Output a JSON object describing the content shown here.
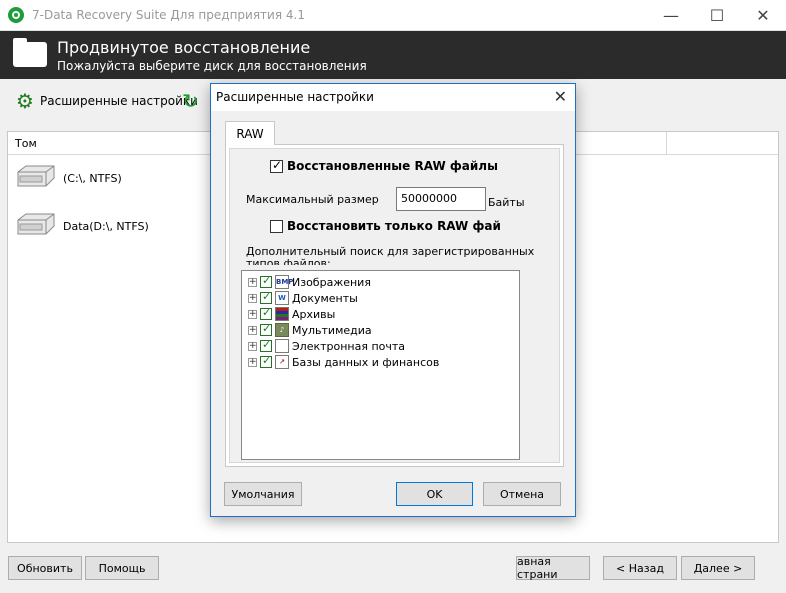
{
  "window": {
    "title": "7-Data Recovery Suite Для предприятия 4.1",
    "minimize": "—",
    "maximize": "☐",
    "close": "✕"
  },
  "header": {
    "title": "Продвинутое восстановление",
    "subtitle": "Пожалуйста выберите диск для восстановления"
  },
  "toolbar": {
    "advanced_label": "Расширенные настройки"
  },
  "volumes": {
    "column_header": "Том",
    "items": [
      {
        "label": "(C:\\, NTFS)"
      },
      {
        "label": "Data(D:\\, NTFS)"
      }
    ]
  },
  "bottom": {
    "refresh": "Обновить",
    "help": "Помощь",
    "home": "авная страни",
    "back": "< Назад",
    "next": "Далее >"
  },
  "modal": {
    "title": "Расширенные настройки",
    "close": "✕",
    "tab_raw": "RAW",
    "recovered_raw_label": "Восстановленные RAW файлы",
    "recovered_raw_checked": true,
    "max_size_label": "Максимальный размер",
    "max_size_value": "50000000",
    "max_size_unit": "Байты",
    "only_raw_label": "Восстановить только RAW фай",
    "only_raw_checked": false,
    "extra_search_label_1": "Дополнительный поиск для зарегистрированных",
    "extra_search_label_2": "типов файлов:",
    "tree": [
      {
        "label": "Изображения",
        "icon": "image-icon"
      },
      {
        "label": "Документы",
        "icon": "document-icon"
      },
      {
        "label": "Архивы",
        "icon": "archive-icon"
      },
      {
        "label": "Мультимедиа",
        "icon": "multimedia-icon"
      },
      {
        "label": "Электронная почта",
        "icon": "email-icon"
      },
      {
        "label": "Базы данных и финансов",
        "icon": "database-icon"
      }
    ],
    "defaults": "Умолчания",
    "ok": "OK",
    "cancel": "Отмена"
  }
}
